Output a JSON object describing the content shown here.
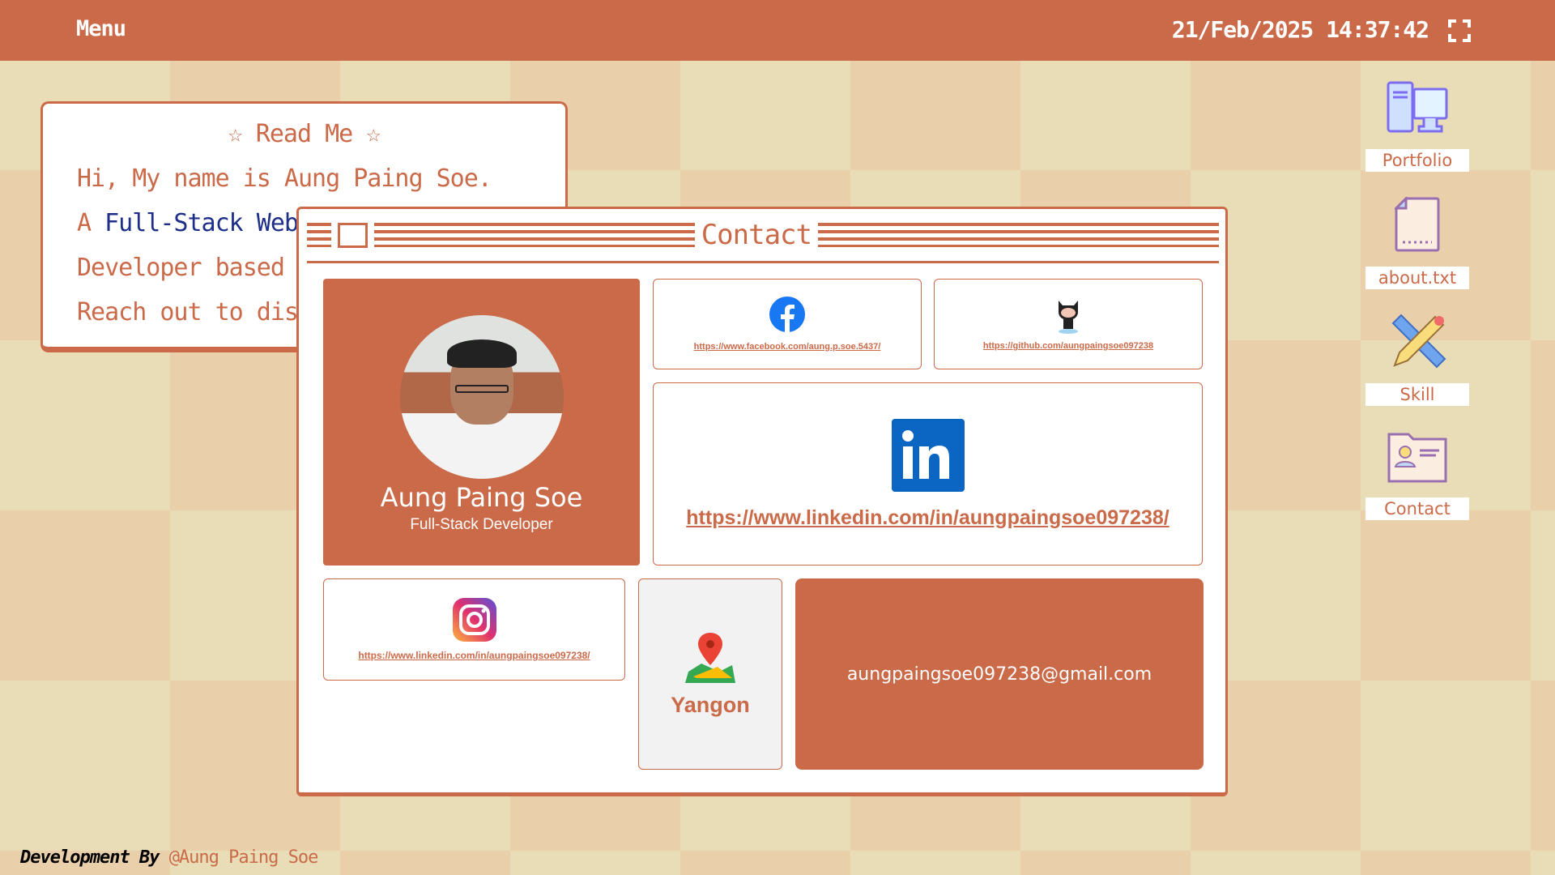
{
  "topbar": {
    "menu": "Menu",
    "datetime": "21/Feb/2025 14:37:42"
  },
  "readme": {
    "title": "Read Me",
    "lines": [
      "Hi, My name is Aung Paing Soe.",
      "A ",
      "Full-Stack Web",
      "Developer based",
      "Reach out to dis"
    ]
  },
  "contact": {
    "title": "Contact",
    "profile": {
      "name": "Aung Paing Soe",
      "role": "Full-Stack Developer"
    },
    "facebook": "https://www.facebook.com/aung.p.soe.5437/",
    "github": "https://github.com/aungpaingsoe097238",
    "linkedin": "https://www.linkedin.com/in/aungpaingsoe097238/",
    "instagram": "https://www.linkedin.com/in/aungpaingsoe097238/",
    "location": "Yangon",
    "email": "aungpaingsoe097238@gmail.com"
  },
  "desktop": [
    {
      "label": "Portfolio"
    },
    {
      "label": "about.txt"
    },
    {
      "label": "Skill"
    },
    {
      "label": "Contact"
    }
  ],
  "footer": {
    "prefix": "Development By",
    "author": "@Aung Paing Soe"
  },
  "colors": {
    "accent": "#cb6a49",
    "text_blue": "#1e2f8a"
  }
}
